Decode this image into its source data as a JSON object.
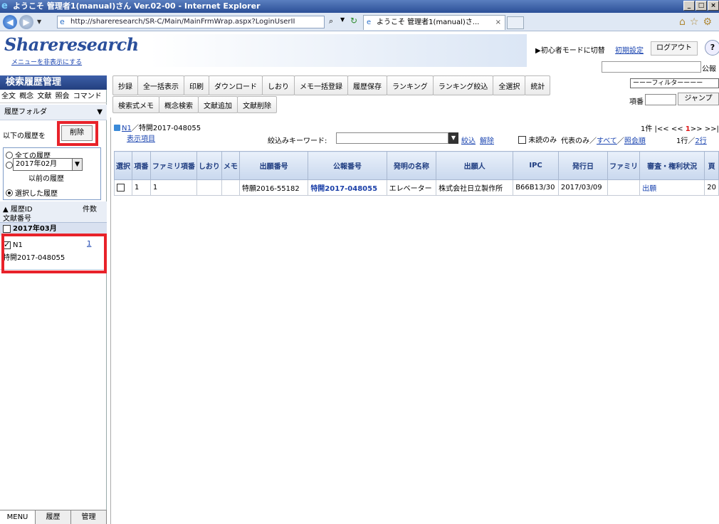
{
  "window": {
    "title": "ようこそ 管理者1(manual)さん  Ver.02-00 - Internet Explorer",
    "url": "http://shareresearch/SR-C/Main/MainFrmWrap.aspx?LoginUserII",
    "tab_title": "ようこそ 管理者1(manual)さ..."
  },
  "header": {
    "logo": "Shareresearch",
    "hide_menu": "メニューを非表示にする",
    "beginner_mode": "▶初心者モードに切替",
    "initial_settings": "初期設定",
    "logout": "ログアウト",
    "help": "?",
    "pub_label": "公報"
  },
  "left": {
    "title": "検索履歴管理",
    "tabs": [
      "全文",
      "概念",
      "文献",
      "照会",
      "コマンド"
    ],
    "folder": "履歴フォルダ",
    "below_history": "以下の履歴を",
    "delete": "削除",
    "radio_all": "全ての履歴",
    "date_value": "2017年02月",
    "radio_before": "以前の履歴",
    "radio_selected": "選択した履歴",
    "col_history_id": "▲ 履歴ID",
    "col_count": "件数",
    "col_doc_no": "文献番号",
    "month": "2017年03月",
    "item_id": "N1",
    "item_count": "1",
    "item_doc": "特開2017-048055",
    "bottom_tabs": [
      "MENU",
      "履歴",
      "管理"
    ]
  },
  "toolbar": {
    "row1": [
      "抄録",
      "全一括表示",
      "印刷",
      "ダウンロード",
      "しおり",
      "メモ一括登録",
      "履歴保存",
      "ランキング",
      "ランキング絞込",
      "全選択",
      "統計"
    ],
    "row2": [
      "検索式メモ",
      "概念検索",
      "文献追加",
      "文献削除"
    ],
    "filter": "ーーーフィルターーーー",
    "item_no": "項番",
    "jump": "ジャンプ"
  },
  "results": {
    "crumb_link": "N1",
    "crumb_rest": "／特開2017-048055",
    "display_items": "表示項目",
    "keyword_label": "絞込みキーワード:",
    "narrow": "絞込",
    "release": "解除",
    "unread_only": "未読のみ",
    "repr_label": "代表のみ／",
    "repr_all": "すべて",
    "repr_sep": "／",
    "repr_order": "照会順",
    "count_prefix": "1件 |<< << ",
    "count_page": "1",
    "count_suffix": ">> >>|",
    "rows_label": "1行／",
    "rows_link": "2行",
    "columns": [
      "選択",
      "項番",
      "ファミリ項番",
      "しおり",
      "メモ",
      "出願番号",
      "公報番号",
      "発明の名称",
      "出願人",
      "IPC",
      "発行日",
      "ファミリ",
      "審査・権利状況",
      "頁"
    ],
    "rows": [
      {
        "item_no": "1",
        "family_no": "1",
        "bookmark": "",
        "memo": "",
        "app_no": "特願2016-55182",
        "pub_no": "特開2017-048055",
        "title": "エレベーター",
        "applicant": "株式会社日立製作所",
        "ipc": "B66B13/30",
        "date": "2017/03/09",
        "family": "",
        "status": "出願",
        "page": "20"
      }
    ]
  }
}
